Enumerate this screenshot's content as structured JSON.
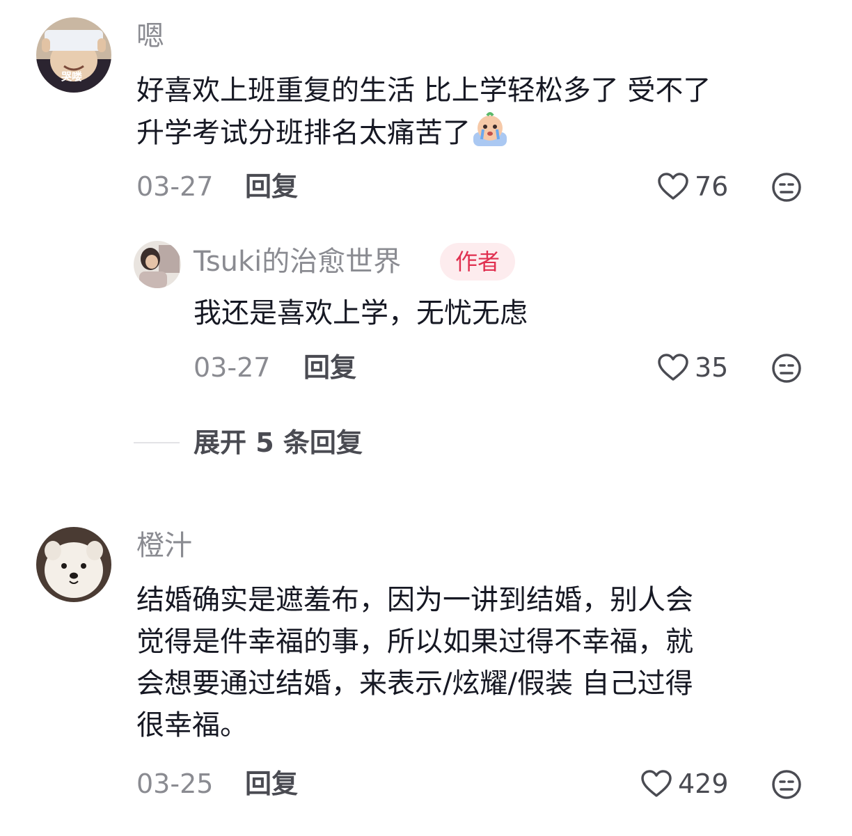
{
  "comments": [
    {
      "username": "嗯",
      "avatar_text": "哭喽",
      "content_lines": [
        "好喜欢上班重复的生活 比上学轻松多了 受不了",
        "升学考试分班排名太痛苦了"
      ],
      "emoji": "crying-emoji",
      "date": "03-27",
      "reply_label": "回复",
      "likes": "76",
      "replies": [
        {
          "username": "Tsuki的治愈世界",
          "badge": "作者",
          "content_lines": [
            "我还是喜欢上学，无忧无虑"
          ],
          "date": "03-27",
          "reply_label": "回复",
          "likes": "35"
        }
      ],
      "expand_label": "展开 5 条回复"
    },
    {
      "username": "橙汁",
      "content_lines": [
        "结婚确实是遮羞布，因为一讲到结婚，别人会",
        "觉得是件幸福的事，所以如果过得不幸福，就",
        "会想要通过结婚，来表示/炫耀/假装 自己过得",
        "很幸福。"
      ],
      "date": "03-25",
      "reply_label": "回复",
      "likes": "429"
    }
  ],
  "colors": {
    "text_primary": "#161823",
    "text_secondary": "#8a8b91",
    "author_badge_bg": "#fdecee",
    "author_badge_text": "#e03050"
  }
}
